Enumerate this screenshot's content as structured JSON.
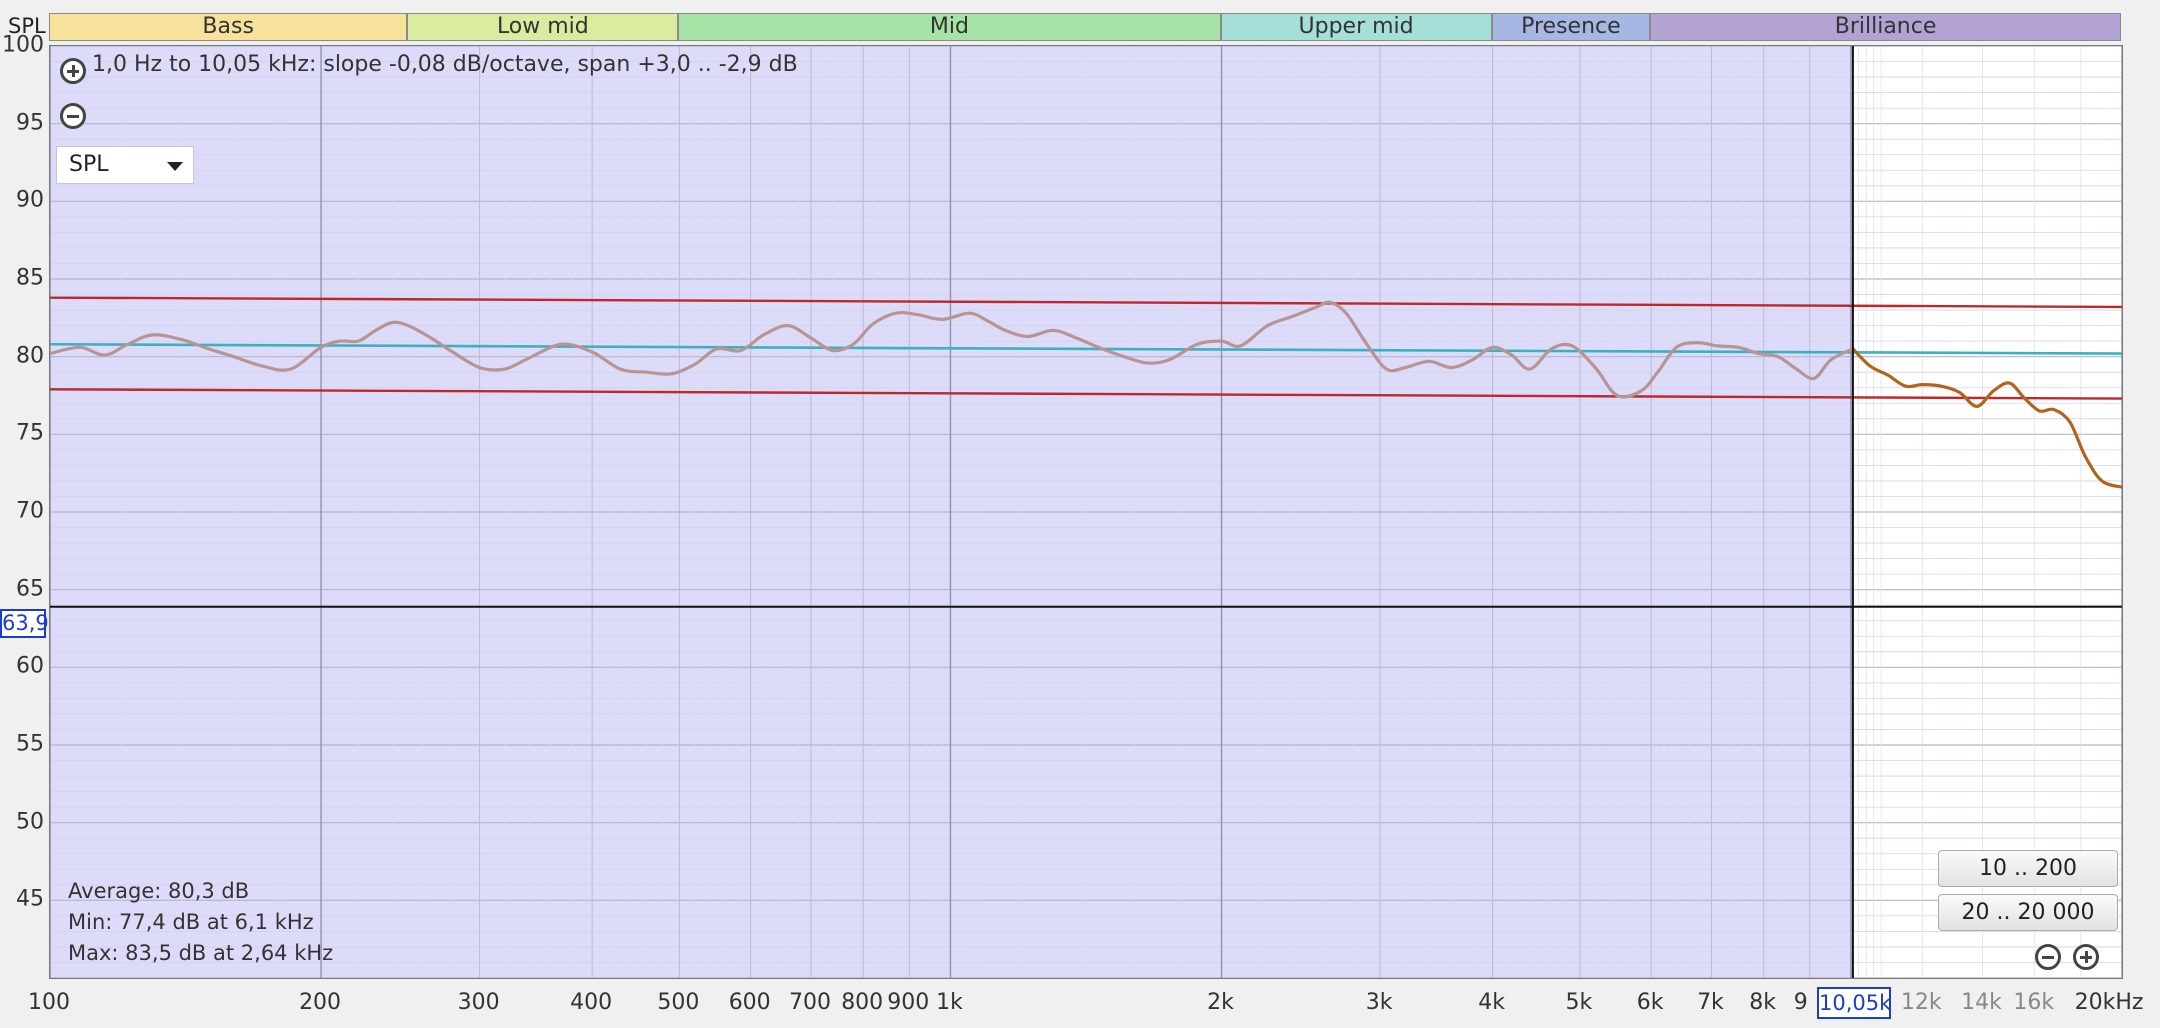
{
  "window": {
    "y_unit_label": "SPL"
  },
  "bands": [
    {
      "label": "Bass",
      "color": "#f6e29a"
    },
    {
      "label": "Low mid",
      "color": "#d9eca0"
    },
    {
      "label": "Mid",
      "color": "#a6e3a6"
    },
    {
      "label": "Upper mid",
      "color": "#a4e0d8"
    },
    {
      "label": "Presence",
      "color": "#a7b7e4"
    },
    {
      "label": "Brilliance",
      "color": "#b2a3d3"
    }
  ],
  "overlay": {
    "fit_text": "1,0 Hz to 10,05 kHz: slope -0,08 dB/octave, span +3,0 .. -2,9 dB",
    "zoom_in_icon": "plus-circle-icon",
    "zoom_out_icon": "minus-circle-icon",
    "measure_select": {
      "value": "SPL",
      "icon": "dropdown-arrow-icon"
    },
    "stats": {
      "average": "Average: 80,3 dB",
      "min": "Min: 77,4 dB at 6,1 kHz",
      "max": "Max: 83,5 dB at 2,64 kHz"
    },
    "range_buttons": [
      "10 .. 200",
      "20 .. 20 000"
    ]
  },
  "cursor": {
    "y_readout": "63,9",
    "x_readout": "10,05k",
    "y_value": 63.9,
    "x_value": 10050
  },
  "colors": {
    "selected_region": "#dcdcfa",
    "response_selected": "#b99494",
    "response_outside": "#b0651a",
    "trend_line": "#3ab0c0",
    "bound_lines": "#c02828",
    "cursor": "#111111"
  },
  "chart_data": {
    "type": "line",
    "x_scale": "log",
    "xlim": [
      100,
      20000
    ],
    "ylim": [
      40,
      100
    ],
    "y_ticks": [
      "100",
      "95",
      "90",
      "85",
      "80",
      "75",
      "70",
      "65",
      "60",
      "55",
      "50",
      "45"
    ],
    "x_ticks": [
      "100",
      "200",
      "300",
      "400",
      "500",
      "600",
      "700",
      "800",
      "900",
      "1k",
      "2k",
      "3k",
      "4k",
      "5k",
      "6k",
      "7k",
      "8k",
      "9",
      "12k",
      "14k",
      "16k",
      "20kHz"
    ],
    "selected_range_hz": [
      100,
      10050
    ],
    "trend": {
      "start": [
        100,
        80.8
      ],
      "end": [
        20000,
        80.2
      ]
    },
    "upper_bound": {
      "start": [
        100,
        83.8
      ],
      "end": [
        20000,
        83.2
      ]
    },
    "lower_bound": {
      "start": [
        100,
        77.9
      ],
      "end": [
        20000,
        77.3
      ]
    },
    "series": [
      {
        "x": [
          100,
          108,
          115,
          122,
          130,
          140,
          150,
          160,
          172,
          185,
          200,
          210,
          220,
          230,
          240,
          250,
          265,
          280,
          300,
          320,
          340,
          370,
          400,
          430,
          460,
          490,
          520,
          550,
          585,
          620,
          660,
          700,
          740,
          780,
          820,
          870,
          920,
          980,
          1050,
          1100,
          1150,
          1220,
          1300,
          1380,
          1460,
          1540,
          1650,
          1750,
          1880,
          2000,
          2100,
          2250,
          2400,
          2550,
          2640,
          2750,
          2900,
          3050,
          3200,
          3400,
          3600,
          3800,
          4000,
          4200,
          4400,
          4650,
          4900,
          5200,
          5500,
          5850,
          6100,
          6400,
          6750,
          7100,
          7500,
          7900,
          8300,
          8700,
          9100,
          9500,
          10050,
          10500,
          11000,
          11500,
          12000,
          12600,
          13200,
          13800,
          14400,
          15000,
          15600,
          16200,
          16800,
          17500,
          18200,
          19000,
          20000
        ],
        "y": [
          80.2,
          80.6,
          80.1,
          80.8,
          81.4,
          81.1,
          80.5,
          80.0,
          79.4,
          79.2,
          80.6,
          81.0,
          81.0,
          81.7,
          82.2,
          82.0,
          81.2,
          80.3,
          79.3,
          79.2,
          79.9,
          80.8,
          80.3,
          79.2,
          79.0,
          78.9,
          79.5,
          80.5,
          80.4,
          81.4,
          82.0,
          81.2,
          80.4,
          80.8,
          82.1,
          82.8,
          82.7,
          82.4,
          82.8,
          82.3,
          81.7,
          81.3,
          81.7,
          81.2,
          80.6,
          80.1,
          79.6,
          79.8,
          80.8,
          81.0,
          80.7,
          82.0,
          82.6,
          83.2,
          83.5,
          82.8,
          80.8,
          79.2,
          79.3,
          79.7,
          79.3,
          79.8,
          80.6,
          80.1,
          79.2,
          80.5,
          80.7,
          79.3,
          77.5,
          77.8,
          79.0,
          80.6,
          80.9,
          80.7,
          80.6,
          80.2,
          80.0,
          79.2,
          78.6,
          79.8,
          80.5,
          79.4,
          78.8,
          78.1,
          78.2,
          78.1,
          77.7,
          76.8,
          77.8,
          78.3,
          77.3,
          76.5,
          76.6,
          75.8,
          73.6,
          72.0,
          71.6
        ]
      }
    ]
  }
}
